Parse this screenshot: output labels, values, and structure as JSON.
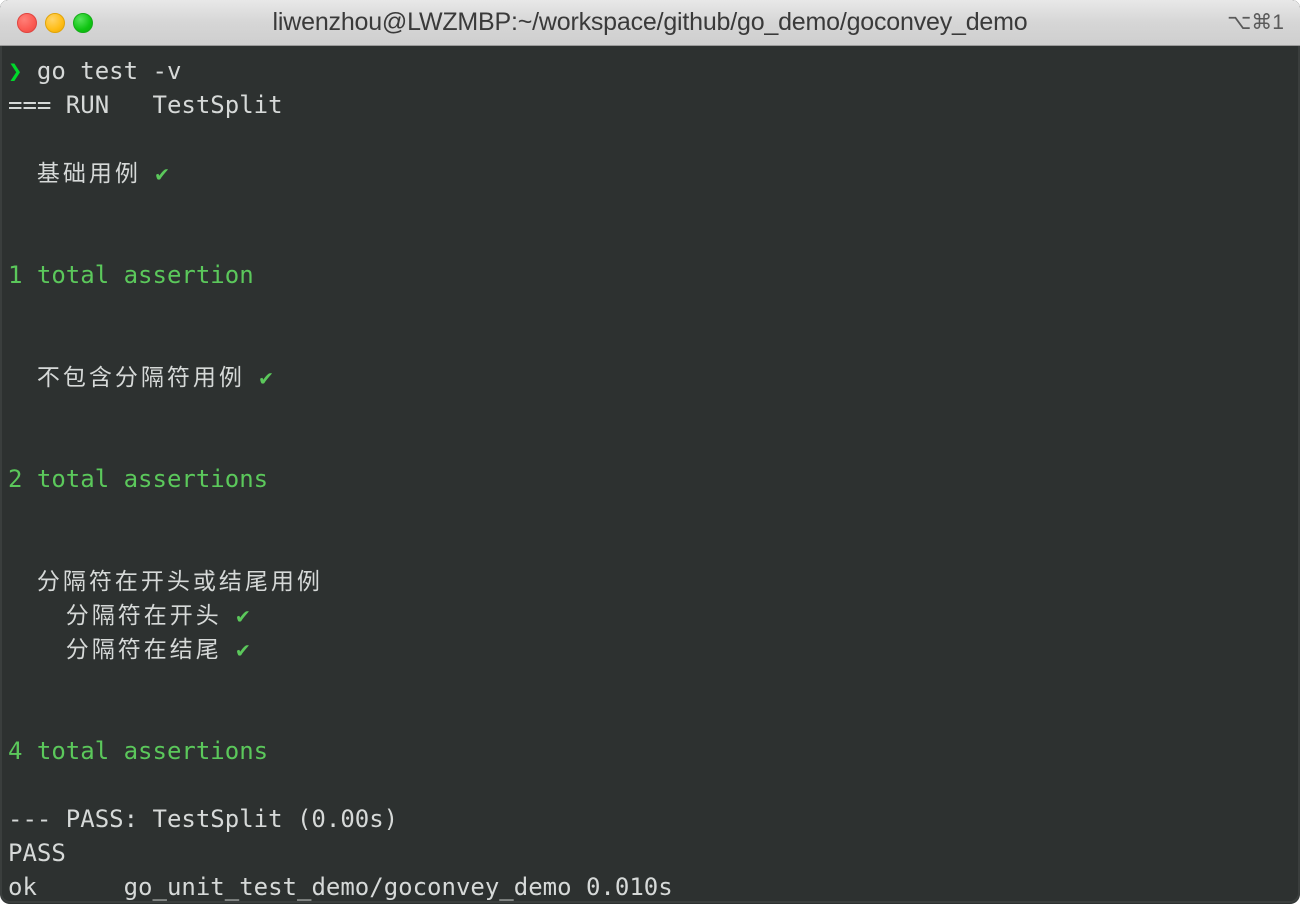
{
  "window": {
    "title": "liwenzhou@LWZMBP:~/workspace/github/go_demo/goconvey_demo",
    "shortcut_hint": "⌥⌘1",
    "traffic_lights": {
      "close_label": "close",
      "minimize_label": "minimize",
      "maximize_label": "maximize",
      "close_color": "#fb5a52",
      "minimize_color": "#ffbd16",
      "maximize_color": "#10c513"
    }
  },
  "theme": {
    "background": "#2d3130",
    "foreground": "#d6d9d8",
    "green": "#5bc85b",
    "prompt_green": "#00d72b"
  },
  "terminal": {
    "prompt_symbol": "❯",
    "command": "go test -v",
    "lines": {
      "run_header": "=== RUN   TestSplit",
      "case1_text": "基础用例",
      "case1_indent": "  ",
      "total1": "1 total assertion",
      "case2_text": "不包含分隔符用例",
      "case2_indent": "  ",
      "total2": "2 total assertions",
      "case3_text": "分隔符在开头或结尾用例",
      "case3_indent": "  ",
      "case3a_text": "分隔符在开头",
      "case3a_indent": "    ",
      "case3b_text": "分隔符在结尾",
      "case3b_indent": "    ",
      "total4": "4 total assertions",
      "pass_detail": "--- PASS: TestSplit (0.00s)",
      "pass": "PASS",
      "ok_status": "ok",
      "ok_spacer": "      ",
      "ok_package": "go_unit_test_demo/goconvey_demo 0.010s"
    },
    "check_glyph": "✔"
  }
}
